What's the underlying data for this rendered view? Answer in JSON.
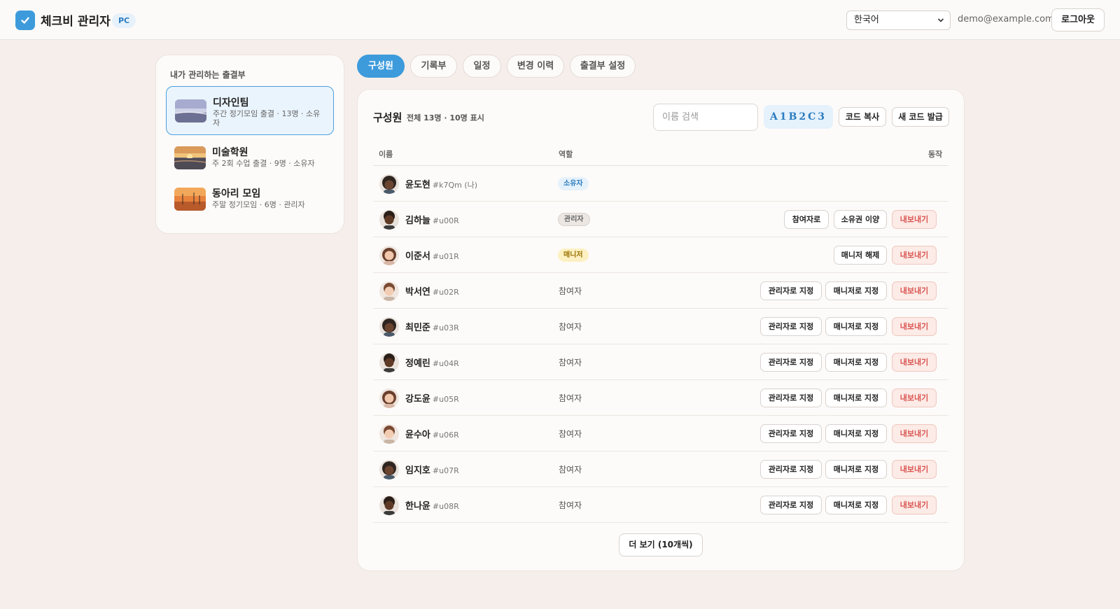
{
  "header": {
    "app_title": "체크비 관리자",
    "badge": "PC",
    "language": "한국어",
    "email": "demo@example.com",
    "logout": "로그아웃"
  },
  "sidebar": {
    "heading": "내가 관리하는 출결부",
    "items": [
      {
        "name": "디자인팀",
        "sub": "주간 정기모임 출결 · 13명 · 소유자",
        "active": true
      },
      {
        "name": "미술학원",
        "sub": "주 2회 수업 출결 · 9명 · 소유자",
        "active": false
      },
      {
        "name": "동아리 모임",
        "sub": "주말 정기모임 · 6명 · 관리자",
        "active": false
      }
    ]
  },
  "tabs": [
    {
      "label": "구성원",
      "active": true
    },
    {
      "label": "기록부",
      "active": false
    },
    {
      "label": "일정",
      "active": false
    },
    {
      "label": "변경 이력",
      "active": false
    },
    {
      "label": "출결부 설정",
      "active": false
    }
  ],
  "members_panel": {
    "title": "구성원",
    "count": "전체 13명 · 10명 표시",
    "search_placeholder": "이름 검색",
    "invite_code": "A1B2C3",
    "copy_code": "코드 복사",
    "new_code": "새 코드 발급",
    "columns": {
      "name": "이름",
      "role": "역할",
      "actions": "동작"
    },
    "members": [
      {
        "name": "윤도현",
        "tag": "#k7Qm (나)",
        "role": "소유자",
        "role_style": "owner",
        "actions": []
      },
      {
        "name": "김하늘",
        "tag": "#u00R",
        "role": "관리자",
        "role_style": "admin",
        "actions": [
          "참여자로",
          "소유권 이양",
          "내보내기"
        ]
      },
      {
        "name": "이준서",
        "tag": "#u01R",
        "role": "매니저",
        "role_style": "manager",
        "actions": [
          "매니저 해제",
          "내보내기"
        ]
      },
      {
        "name": "박서연",
        "tag": "#u02R",
        "role": "참여자",
        "role_style": "plain",
        "actions": [
          "관리자로 지정",
          "매니저로 지정",
          "내보내기"
        ]
      },
      {
        "name": "최민준",
        "tag": "#u03R",
        "role": "참여자",
        "role_style": "plain",
        "actions": [
          "관리자로 지정",
          "매니저로 지정",
          "내보내기"
        ]
      },
      {
        "name": "정예린",
        "tag": "#u04R",
        "role": "참여자",
        "role_style": "plain",
        "actions": [
          "관리자로 지정",
          "매니저로 지정",
          "내보내기"
        ]
      },
      {
        "name": "강도윤",
        "tag": "#u05R",
        "role": "참여자",
        "role_style": "plain",
        "actions": [
          "관리자로 지정",
          "매니저로 지정",
          "내보내기"
        ]
      },
      {
        "name": "윤수아",
        "tag": "#u06R",
        "role": "참여자",
        "role_style": "plain",
        "actions": [
          "관리자로 지정",
          "매니저로 지정",
          "내보내기"
        ]
      },
      {
        "name": "임지호",
        "tag": "#u07R",
        "role": "참여자",
        "role_style": "plain",
        "actions": [
          "관리자로 지정",
          "매니저로 지정",
          "내보내기"
        ]
      },
      {
        "name": "한나윤",
        "tag": "#u08R",
        "role": "참여자",
        "role_style": "plain",
        "actions": [
          "관리자로 지정",
          "매니저로 지정",
          "내보내기"
        ]
      }
    ],
    "load_more": "더 보기 (10개씩)"
  },
  "colors": {
    "accent": "#3d9bdc",
    "background": "#f5eeea",
    "danger": "#d9534f",
    "owner_badge_bg": "#e5f1fb",
    "admin_badge_bg": "#ece7e3",
    "manager_badge_bg": "#fdf0c2"
  }
}
